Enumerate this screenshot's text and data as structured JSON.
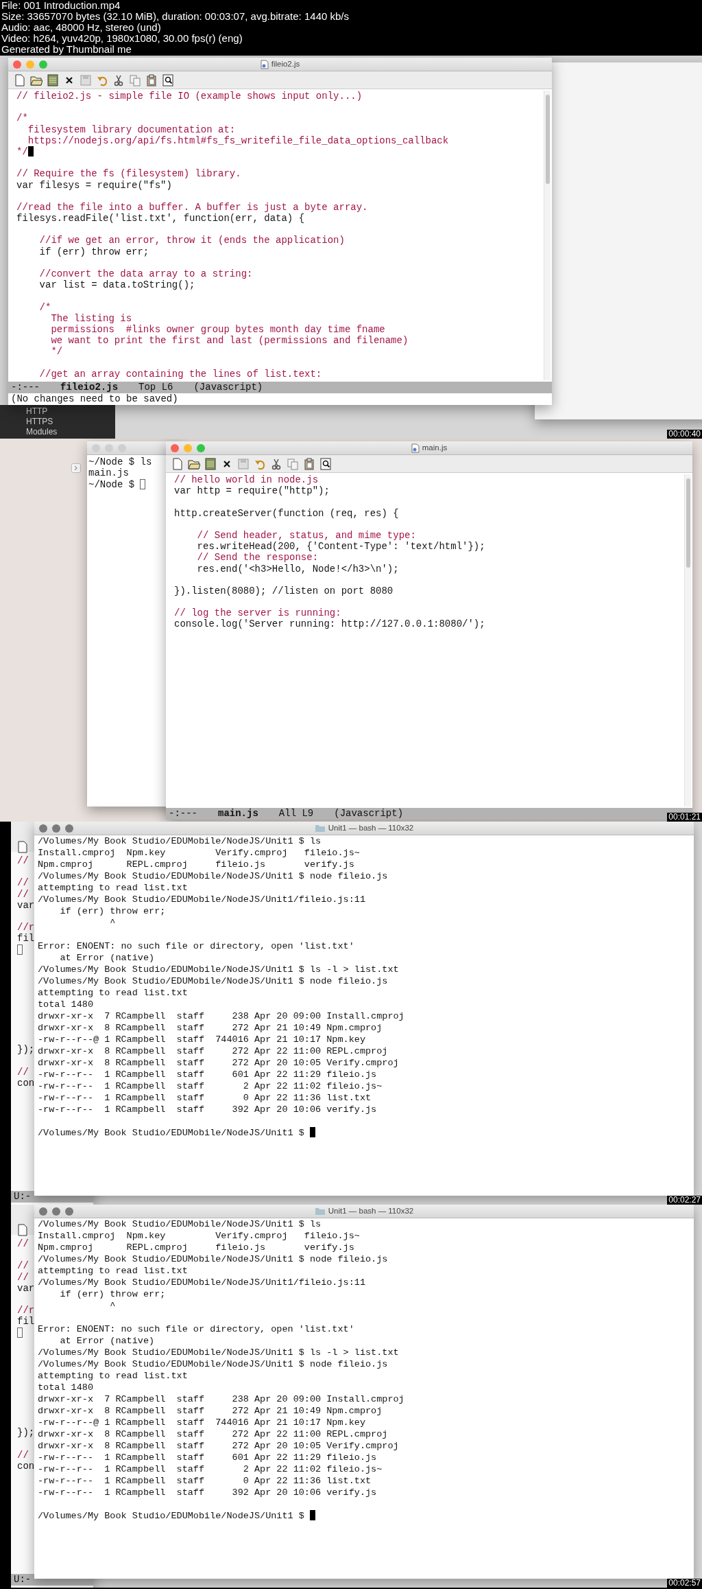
{
  "file_info": [
    "File: 001 Introduction.mp4",
    "Size: 33657070 bytes (32.10 MiB), duration: 00:03:07, avg.bitrate: 1440 kb/s",
    "Audio: aac, 48000 Hz, stereo (und)",
    "Video: h264, yuv420p, 1980x1080, 30.00 fps(r) (eng)",
    "Generated by Thumbnail me"
  ],
  "frames": [
    {
      "timestamp": "00:00:40",
      "background_menu": [
        "HTTP",
        "HTTPS",
        "Modules"
      ],
      "editor": {
        "title": "fileio2.js",
        "focused": true,
        "lines": [
          {
            "kind": "comment",
            "text": "// fileio2.js - simple file IO (example shows input only...)"
          },
          {
            "kind": "blank"
          },
          {
            "kind": "comment",
            "text": "/*"
          },
          {
            "kind": "comment",
            "text": "  filesystem library documentation at:"
          },
          {
            "kind": "comment",
            "text": "  https://nodejs.org/api/fs.html#fs_fs_writefile_file_data_options_callback"
          },
          {
            "kind": "comment",
            "text": "*/",
            "cursor": true
          },
          {
            "kind": "blank"
          },
          {
            "kind": "comment",
            "text": "// Require the fs (filesystem) library."
          },
          {
            "kind": "code",
            "text": "var filesys = require(\"fs\")"
          },
          {
            "kind": "blank"
          },
          {
            "kind": "comment",
            "text": "//read the file into a buffer. A buffer is just a byte array."
          },
          {
            "kind": "code",
            "text": "filesys.readFile('list.txt', function(err, data) {"
          },
          {
            "kind": "blank"
          },
          {
            "kind": "comment",
            "text": "    //if we get an error, throw it (ends the application)"
          },
          {
            "kind": "code",
            "text": "    if (err) throw err;"
          },
          {
            "kind": "blank"
          },
          {
            "kind": "comment",
            "text": "    //convert the data array to a string:"
          },
          {
            "kind": "code",
            "text": "    var list = data.toString();"
          },
          {
            "kind": "blank"
          },
          {
            "kind": "comment",
            "text": "    /*"
          },
          {
            "kind": "comment",
            "text": "      The listing is"
          },
          {
            "kind": "comment",
            "text": "      permissions  #links owner group bytes month day time fname"
          },
          {
            "kind": "comment",
            "text": "      we want to print the first and last (permissions and filename)"
          },
          {
            "kind": "comment",
            "text": "      */"
          },
          {
            "kind": "blank"
          },
          {
            "kind": "comment",
            "text": "    //get an array containing the lines of list.text:"
          }
        ],
        "mode_line": {
          "status": "-:---",
          "buffer": "fileio2.js",
          "position": "Top L6",
          "mode": "(Javascript)"
        },
        "echo_area": "(No changes need to be saved)"
      }
    },
    {
      "timestamp": "00:01:21",
      "terminal": {
        "focused": false,
        "cursor": true,
        "lines": [
          {
            "kind": "text",
            "text": "~/Node $ ls"
          },
          {
            "kind": "text",
            "text": "main.js"
          },
          {
            "kind": "text",
            "text": "~/Node $"
          }
        ]
      },
      "editor": {
        "title": "main.js",
        "focused": true,
        "lines": [
          {
            "kind": "comment",
            "text": "// hello world in node.js"
          },
          {
            "kind": "code",
            "text": "var http = require(\"http\");"
          },
          {
            "kind": "blank"
          },
          {
            "kind": "code",
            "text": "http.createServer(function (req, res) {"
          },
          {
            "kind": "blank"
          },
          {
            "kind": "comment",
            "text": "    // Send header, status, and mime type:"
          },
          {
            "kind": "code",
            "text": "    res.writeHead(200, {'Content-Type': 'text/html'});"
          },
          {
            "kind": "comment",
            "text": "    // Send the response:"
          },
          {
            "kind": "code",
            "text": "    res.end('<h3>Hello, Node!</h3>\\n');"
          },
          {
            "kind": "blank"
          },
          {
            "kind": "code",
            "text": "}).listen(8080); //listen on port 8080"
          },
          {
            "kind": "blank"
          },
          {
            "kind": "comment",
            "text": "// log the server is running:"
          },
          {
            "kind": "code",
            "text": "console.log('Server running: http://127.0.0.1:8080/');"
          }
        ],
        "mode_line": {
          "status": "-:---",
          "buffer": "main.js",
          "position": "All L9",
          "mode": "(Javascript)"
        }
      }
    },
    {
      "timestamp": "00:02:27",
      "background_editor": {
        "focused": false,
        "lines": [
          {
            "kind": "comment",
            "text": "//"
          },
          {
            "kind": "blank"
          },
          {
            "kind": "comment",
            "text": "//"
          },
          {
            "kind": "comment",
            "text": "//"
          },
          {
            "kind": "code",
            "text": "var"
          },
          {
            "kind": "blank"
          },
          {
            "kind": "comment",
            "text": "//r"
          },
          {
            "kind": "code",
            "text": "fil"
          },
          {
            "kind": "code",
            "cursor": true
          },
          {
            "kind": "blank"
          },
          {
            "kind": "blank"
          },
          {
            "kind": "blank"
          },
          {
            "kind": "blank"
          },
          {
            "kind": "blank"
          },
          {
            "kind": "blank"
          },
          {
            "kind": "blank"
          },
          {
            "kind": "blank"
          },
          {
            "kind": "code",
            "text": "});"
          },
          {
            "kind": "blank"
          },
          {
            "kind": "comment",
            "text": "//"
          },
          {
            "kind": "code",
            "text": "con"
          }
        ],
        "mode_line": "U:-"
      },
      "terminal": {
        "title": "Unit1 — bash — 110x32",
        "focused": true,
        "cursor": true,
        "lines": [
          {
            "kind": "text",
            "text": "/Volumes/My Book Studio/EDUMobile/NodeJS/Unit1 $ ls"
          },
          {
            "kind": "text",
            "text": "Install.cmproj  Npm.key         Verify.cmproj   fileio.js~"
          },
          {
            "kind": "text",
            "text": "Npm.cmproj      REPL.cmproj     fileio.js       verify.js"
          },
          {
            "kind": "text",
            "text": "/Volumes/My Book Studio/EDUMobile/NodeJS/Unit1 $ node fileio.js"
          },
          {
            "kind": "text",
            "text": "attempting to read list.txt"
          },
          {
            "kind": "text",
            "text": "/Volumes/My Book Studio/EDUMobile/NodeJS/Unit1/fileio.js:11"
          },
          {
            "kind": "text",
            "text": "    if (err) throw err;"
          },
          {
            "kind": "text",
            "text": "             ^"
          },
          {
            "kind": "blank"
          },
          {
            "kind": "text",
            "text": "Error: ENOENT: no such file or directory, open 'list.txt'"
          },
          {
            "kind": "text",
            "text": "    at Error (native)"
          },
          {
            "kind": "text",
            "text": "/Volumes/My Book Studio/EDUMobile/NodeJS/Unit1 $ ls -l > list.txt"
          },
          {
            "kind": "text",
            "text": "/Volumes/My Book Studio/EDUMobile/NodeJS/Unit1 $ node fileio.js"
          },
          {
            "kind": "text",
            "text": "attempting to read list.txt"
          },
          {
            "kind": "text",
            "text": "total 1480"
          },
          {
            "kind": "text",
            "text": "drwxr-xr-x  7 RCampbell  staff     238 Apr 20 09:00 Install.cmproj"
          },
          {
            "kind": "text",
            "text": "drwxr-xr-x  8 RCampbell  staff     272 Apr 21 10:49 Npm.cmproj"
          },
          {
            "kind": "text",
            "text": "-rw-r--r--@ 1 RCampbell  staff  744016 Apr 21 10:17 Npm.key"
          },
          {
            "kind": "text",
            "text": "drwxr-xr-x  8 RCampbell  staff     272 Apr 22 11:00 REPL.cmproj"
          },
          {
            "kind": "text",
            "text": "drwxr-xr-x  8 RCampbell  staff     272 Apr 20 10:05 Verify.cmproj"
          },
          {
            "kind": "text",
            "text": "-rw-r--r--  1 RCampbell  staff     601 Apr 22 11:29 fileio.js"
          },
          {
            "kind": "text",
            "text": "-rw-r--r--  1 RCampbell  staff       2 Apr 22 11:02 fileio.js~"
          },
          {
            "kind": "text",
            "text": "-rw-r--r--  1 RCampbell  staff       0 Apr 22 11:36 list.txt"
          },
          {
            "kind": "text",
            "text": "-rw-r--r--  1 RCampbell  staff     392 Apr 20 10:06 verify.js"
          },
          {
            "kind": "blank"
          },
          {
            "kind": "text",
            "text": "/Volumes/My Book Studio/EDUMobile/NodeJS/Unit1 $"
          }
        ]
      }
    },
    {
      "timestamp": "00:02:57",
      "background_editor": {
        "focused": false,
        "lines": [
          {
            "kind": "comment",
            "text": "//"
          },
          {
            "kind": "blank"
          },
          {
            "kind": "comment",
            "text": "//"
          },
          {
            "kind": "comment",
            "text": "//"
          },
          {
            "kind": "code",
            "text": "var"
          },
          {
            "kind": "blank"
          },
          {
            "kind": "comment",
            "text": "//r"
          },
          {
            "kind": "code",
            "text": "fil"
          },
          {
            "kind": "code",
            "cursor": true
          },
          {
            "kind": "blank"
          },
          {
            "kind": "blank"
          },
          {
            "kind": "blank"
          },
          {
            "kind": "blank"
          },
          {
            "kind": "blank"
          },
          {
            "kind": "blank"
          },
          {
            "kind": "blank"
          },
          {
            "kind": "blank"
          },
          {
            "kind": "code",
            "text": "});"
          },
          {
            "kind": "blank"
          },
          {
            "kind": "comment",
            "text": "//"
          },
          {
            "kind": "code",
            "text": "con"
          }
        ],
        "mode_line": "U:-"
      },
      "terminal": {
        "title": "Unit1 — bash — 110x32",
        "focused": true,
        "cursor": true,
        "lines": [
          {
            "kind": "text",
            "text": "/Volumes/My Book Studio/EDUMobile/NodeJS/Unit1 $ ls"
          },
          {
            "kind": "text",
            "text": "Install.cmproj  Npm.key         Verify.cmproj   fileio.js~"
          },
          {
            "kind": "text",
            "text": "Npm.cmproj      REPL.cmproj     fileio.js       verify.js"
          },
          {
            "kind": "text",
            "text": "/Volumes/My Book Studio/EDUMobile/NodeJS/Unit1 $ node fileio.js"
          },
          {
            "kind": "text",
            "text": "attempting to read list.txt"
          },
          {
            "kind": "text",
            "text": "/Volumes/My Book Studio/EDUMobile/NodeJS/Unit1/fileio.js:11"
          },
          {
            "kind": "text",
            "text": "    if (err) throw err;"
          },
          {
            "kind": "text",
            "text": "             ^"
          },
          {
            "kind": "blank"
          },
          {
            "kind": "text",
            "text": "Error: ENOENT: no such file or directory, open 'list.txt'"
          },
          {
            "kind": "text",
            "text": "    at Error (native)"
          },
          {
            "kind": "text",
            "text": "/Volumes/My Book Studio/EDUMobile/NodeJS/Unit1 $ ls -l > list.txt"
          },
          {
            "kind": "text",
            "text": "/Volumes/My Book Studio/EDUMobile/NodeJS/Unit1 $ node fileio.js"
          },
          {
            "kind": "text",
            "text": "attempting to read list.txt"
          },
          {
            "kind": "text",
            "text": "total 1480"
          },
          {
            "kind": "text",
            "text": "drwxr-xr-x  7 RCampbell  staff     238 Apr 20 09:00 Install.cmproj"
          },
          {
            "kind": "text",
            "text": "drwxr-xr-x  8 RCampbell  staff     272 Apr 21 10:49 Npm.cmproj"
          },
          {
            "kind": "text",
            "text": "-rw-r--r--@ 1 RCampbell  staff  744016 Apr 21 10:17 Npm.key"
          },
          {
            "kind": "text",
            "text": "drwxr-xr-x  8 RCampbell  staff     272 Apr 22 11:00 REPL.cmproj"
          },
          {
            "kind": "text",
            "text": "drwxr-xr-x  8 RCampbell  staff     272 Apr 20 10:05 Verify.cmproj"
          },
          {
            "kind": "text",
            "text": "-rw-r--r--  1 RCampbell  staff     601 Apr 22 11:29 fileio.js"
          },
          {
            "kind": "text",
            "text": "-rw-r--r--  1 RCampbell  staff       2 Apr 22 11:02 fileio.js~"
          },
          {
            "kind": "text",
            "text": "-rw-r--r--  1 RCampbell  staff       0 Apr 22 11:36 list.txt"
          },
          {
            "kind": "text",
            "text": "-rw-r--r--  1 RCampbell  staff     392 Apr 20 10:06 verify.js"
          },
          {
            "kind": "blank"
          },
          {
            "kind": "text",
            "text": "/Volumes/My Book Studio/EDUMobile/NodeJS/Unit1 $"
          }
        ]
      }
    }
  ]
}
